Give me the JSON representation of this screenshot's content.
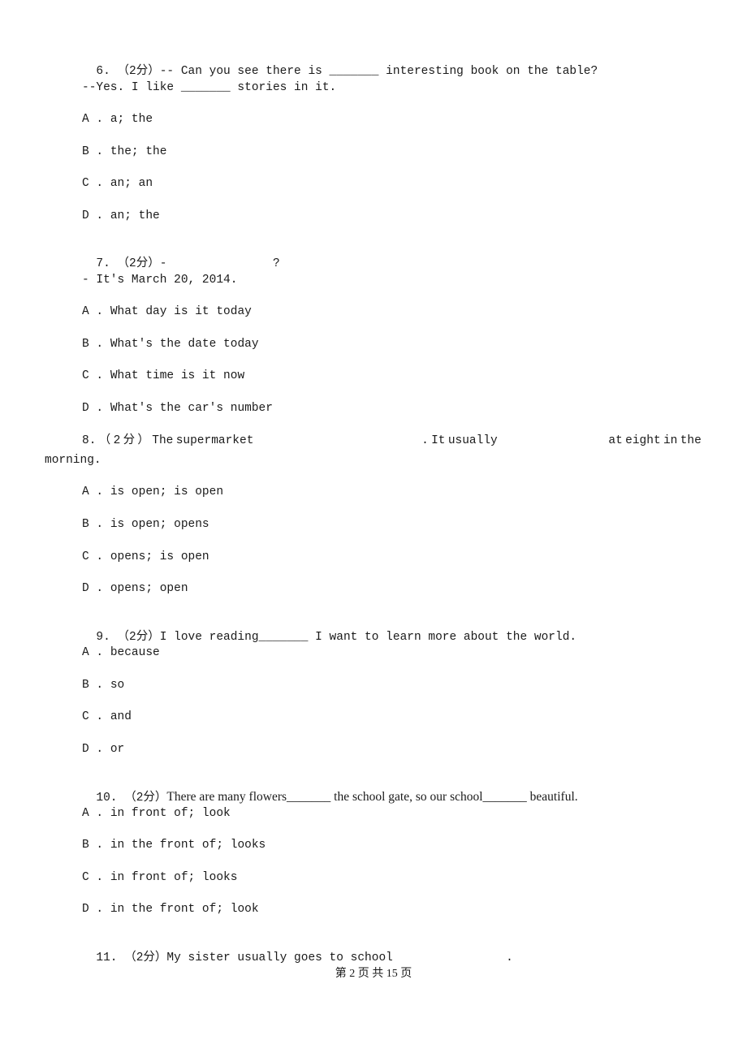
{
  "questions": [
    {
      "number": "6.",
      "score": "（2分）",
      "lines": [
        "-- Can you see there is _______ interesting book on the table?",
        "--Yes. I like _______ stories in it."
      ],
      "options": [
        {
          "letter": "A",
          "text": "a; the"
        },
        {
          "letter": "B",
          "text": "the; the"
        },
        {
          "letter": "C",
          "text": "an; an"
        },
        {
          "letter": "D",
          "text": "an; the"
        }
      ]
    },
    {
      "number": "7.",
      "score": "（2分）",
      "lines": [
        "-               ?",
        "- It's March 20, 2014."
      ],
      "options": [
        {
          "letter": "A",
          "text": "What day is it today"
        },
        {
          "letter": "B",
          "text": "What's the date today"
        },
        {
          "letter": "C",
          "text": "What time is it now"
        },
        {
          "letter": "D",
          "text": "What's the car's number"
        }
      ]
    },
    {
      "number": "8.",
      "score": "（2分）",
      "parts": [
        "8.",
        "（",
        "2",
        "分",
        "）",
        "The",
        "supermarket",
        "",
        ".",
        "It",
        "usually",
        "",
        "at",
        "eight",
        "in",
        "the"
      ],
      "lines": [
        "The supermarket               . It usually                 at eight in the",
        "morning."
      ],
      "options": [
        {
          "letter": "A",
          "text": "is open; is open"
        },
        {
          "letter": "B",
          "text": "is open; opens"
        },
        {
          "letter": "C",
          "text": "opens; is open"
        },
        {
          "letter": "D",
          "text": "opens; open"
        }
      ]
    },
    {
      "number": "9.",
      "score": "（2分）",
      "lines": [
        "I love reading_______ I want to learn more about the world."
      ],
      "options": [
        {
          "letter": "A",
          "text": "because"
        },
        {
          "letter": "B",
          "text": "so"
        },
        {
          "letter": "C",
          "text": "and"
        },
        {
          "letter": "D",
          "text": "or"
        }
      ]
    },
    {
      "number": "10.",
      "score": "（2分）",
      "lines": [
        "There are many flowers_______ the school gate, so our school_______ beautiful."
      ],
      "options": [
        {
          "letter": "A",
          "text": "in front of; look"
        },
        {
          "letter": "B",
          "text": "in the front of; looks"
        },
        {
          "letter": "C",
          "text": "in front of; looks"
        },
        {
          "letter": "D",
          "text": "in the front of; look"
        }
      ]
    },
    {
      "number": "11.",
      "score": "（2分）",
      "lines": [
        "My sister usually goes to school                ."
      ]
    }
  ],
  "footer": {
    "text": "第 2 页 共 15 页"
  }
}
